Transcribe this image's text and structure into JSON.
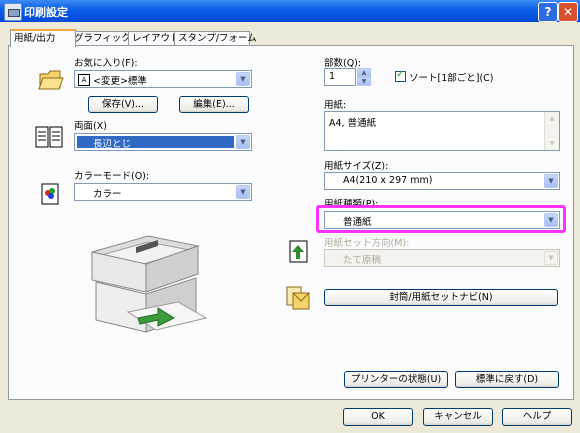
{
  "window": {
    "title": "印刷設定",
    "help_btn": "?",
    "close_btn": "✕"
  },
  "tabs": [
    "用紙/出力",
    "グラフィックス",
    "レイアウト",
    "スタンプ/フォーム"
  ],
  "favorites": {
    "label": "お気に入り(F):",
    "value": "<変更>標準",
    "save": "保存(V)...",
    "edit": "編集(E)..."
  },
  "duplex": {
    "label": "両面(X)",
    "value": "長辺とじ"
  },
  "color_mode": {
    "label": "カラーモード(O):",
    "value": "カラー"
  },
  "copies": {
    "label": "部数(Q):",
    "value": "1",
    "collate_label": "ソート[1部ごと](C)"
  },
  "paper": {
    "label": "用紙:",
    "value": "A4, 普通紙"
  },
  "paper_size": {
    "label": "用紙サイズ(Z):",
    "value": "A4(210 x 297 mm)"
  },
  "paper_type": {
    "label": "用紙種類(P):",
    "value": "普通紙"
  },
  "paper_orientation": {
    "label": "用紙セット方向(M):",
    "value": "たて原稿"
  },
  "envelope_button": "封筒/用紙セットナビ(N)",
  "printer_status_button": "プリンターの状態(U)",
  "defaults_button": "標準に戻す(D)",
  "ok_button": "OK",
  "cancel_button": "キャンセル",
  "help_button": "ヘルプ",
  "colors": {
    "titlebar": "#0a5de6",
    "highlight": "#ff33ff",
    "selection": "#316ac5"
  }
}
